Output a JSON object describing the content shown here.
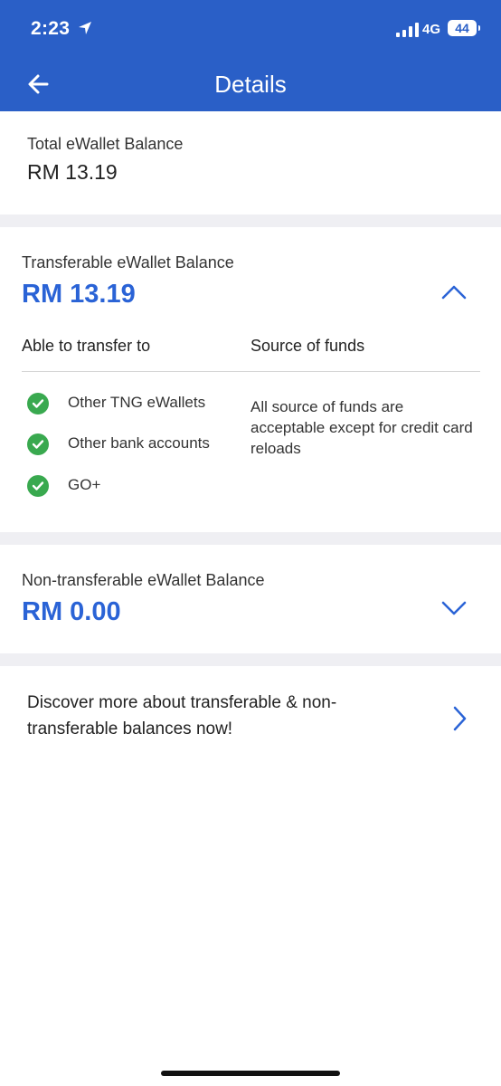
{
  "status_bar": {
    "time": "2:23",
    "network": "4G",
    "battery": "44"
  },
  "header": {
    "title": "Details"
  },
  "total": {
    "label": "Total eWallet Balance",
    "amount": "RM 13.19"
  },
  "transferable": {
    "label": "Transferable eWallet Balance",
    "amount": "RM 13.19",
    "col_transfer_header": "Able to transfer to",
    "col_source_header": "Source of funds",
    "destinations": [
      "Other TNG eWallets",
      "Other bank accounts",
      "GO+"
    ],
    "source_text": "All source of funds are acceptable except for credit card reloads"
  },
  "non_transferable": {
    "label": "Non-transferable eWallet Balance",
    "amount": "RM 0.00"
  },
  "discover": {
    "text": "Discover more about transferable & non-transferable balances now!"
  },
  "colors": {
    "header_bg": "#2a5fc7",
    "accent": "#2a63d6",
    "check": "#39a94f"
  }
}
